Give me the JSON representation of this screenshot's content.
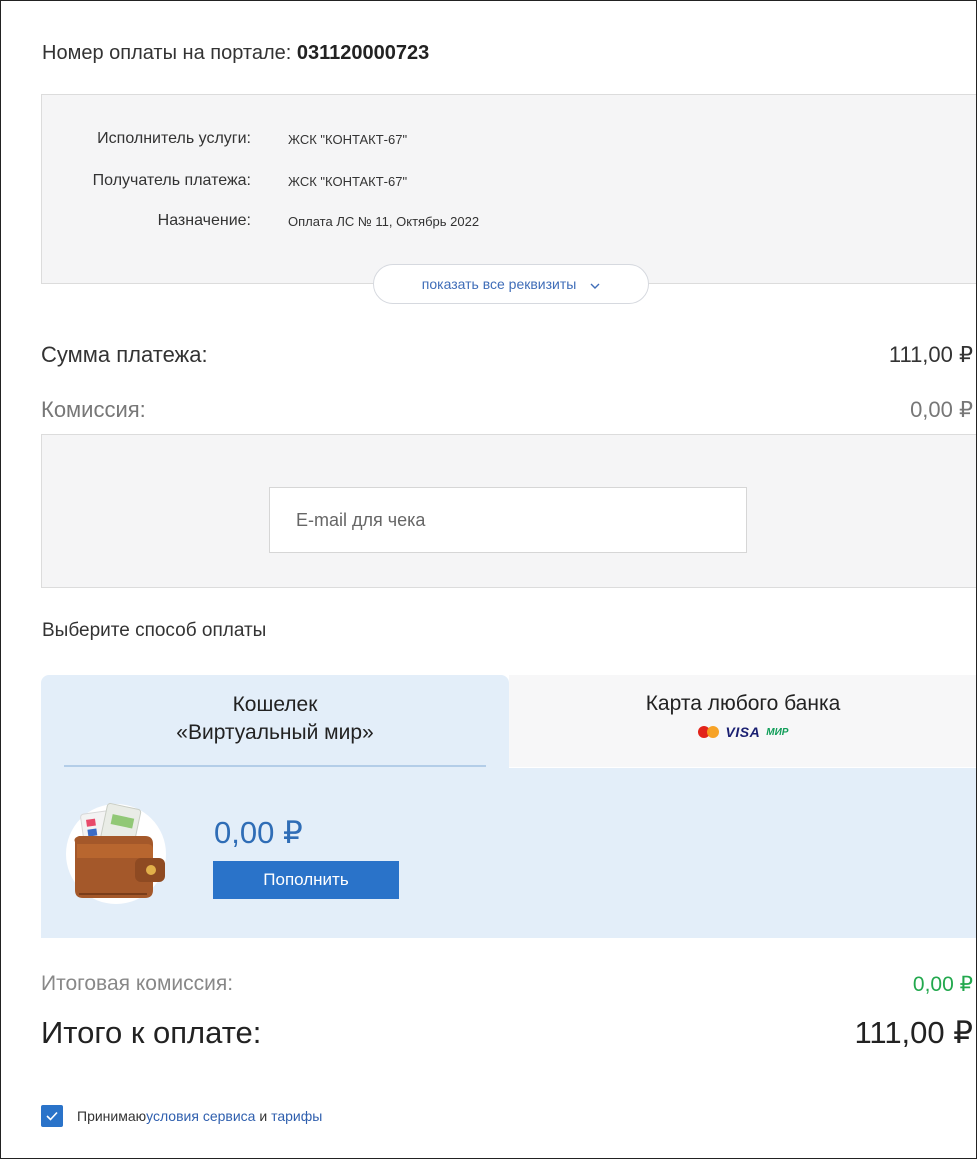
{
  "payment_number": {
    "label": "Номер оплаты на портале:",
    "value": "031120000723"
  },
  "details": {
    "rows": [
      {
        "label": "Исполнитель услуги:",
        "value": "ЖСК \"КОНТАКТ-67\""
      },
      {
        "label": "Получатель платежа:",
        "value": "ЖСК \"КОНТАКТ-67\""
      },
      {
        "label": "Назначение:",
        "value": "Оплата ЛС № 11, Октябрь 2022"
      }
    ],
    "show_all_label": "показать все реквизиты"
  },
  "amounts": {
    "sum_label": "Сумма платежа:",
    "sum_value": "111,00 ₽",
    "commission_label": "Комиссия:",
    "commission_value": "0,00 ₽"
  },
  "email": {
    "placeholder": "E-mail для чека",
    "value": ""
  },
  "payment_method": {
    "title": "Выберите способ оплаты",
    "tabs": [
      {
        "label_line1": "Кошелек",
        "label_line2": "«Виртуальный мир»",
        "active": true
      },
      {
        "label_line1": "Карта любого банка",
        "logos": [
          "mastercard-icon",
          "visa-icon",
          "mir-icon"
        ],
        "active": false
      }
    ],
    "logo_text": {
      "visa": "VISA",
      "mir": "МИР"
    },
    "wallet": {
      "balance": "0,00 ₽",
      "topup_label": "Пополнить",
      "icon": "wallet-icon"
    }
  },
  "totals": {
    "commission_label": "Итоговая комиссия:",
    "commission_value": "0,00 ₽",
    "total_label": "Итого к оплате:",
    "total_value": "111,00 ₽"
  },
  "agreement": {
    "checked": true,
    "prefix": "Принимаю ",
    "link1": "условия сервиса",
    "middle": " и ",
    "link2": "тарифы"
  },
  "colors": {
    "accent": "#2a73c9",
    "link": "#3f6db8",
    "panel_bg": "#e3eef9",
    "success": "#22a84d"
  }
}
